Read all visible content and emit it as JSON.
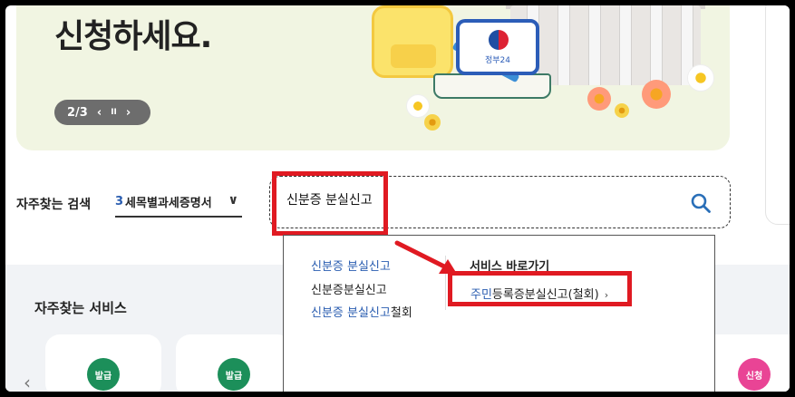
{
  "banner": {
    "headline": "신청하세요.",
    "pager": {
      "current": "2/3",
      "prev": "‹",
      "pause": "II",
      "next": "›"
    },
    "card_label": "정부24"
  },
  "search": {
    "favorites_label": "자주찾는 검색",
    "favorite_select": {
      "number": "3",
      "text": "세목별과세증명서",
      "chevron": "∨"
    },
    "query": "신분증 분실신고"
  },
  "autocomplete": {
    "suggestions": [
      {
        "keyword": "신분증 분실신고",
        "rest": ""
      },
      {
        "keyword": "",
        "rest": "신분증분실신고"
      },
      {
        "keyword": "신분증 분실신고",
        "rest": "철회"
      }
    ],
    "service_title": "서비스 바로가기",
    "service_link": {
      "keyword": "주민",
      "rest": "등록증분실신고(철회)",
      "arrow": "›"
    }
  },
  "services": {
    "title": "자주찾는 서비스",
    "badges": [
      "발급",
      "발급",
      "신청"
    ]
  },
  "colors": {
    "accent_blue": "#2a5db0",
    "highlight_red": "#e01a22",
    "badge_green": "#1c8f5a",
    "badge_pink": "#e94495"
  }
}
